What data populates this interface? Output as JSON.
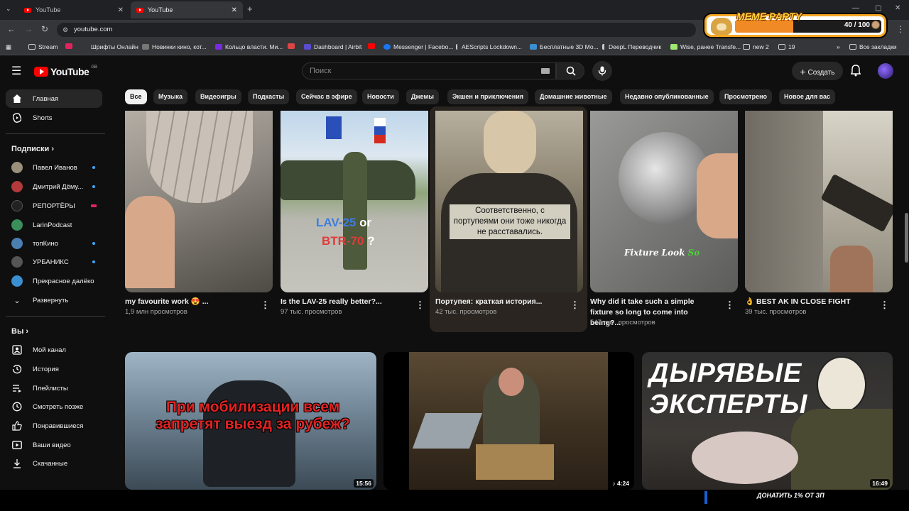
{
  "browser": {
    "tabs": [
      {
        "title": "YouTube",
        "active": false
      },
      {
        "title": "YouTube",
        "active": true
      }
    ],
    "url": "youtube.com",
    "bookmarks": [
      "Stream",
      "Шрифты Онлайн",
      "Новинки кино, кот...",
      "Кольцо власти. Ми...",
      "Dashboard | Airbit",
      "Messenger | Facebo...",
      "AEScripts Lockdown...",
      "Бесплатные 3D Мо...",
      "DeepL Переводчик",
      "Wise, ранее Transfe...",
      "new 2",
      "19"
    ],
    "all_bookmarks": "Все закладки"
  },
  "meme_party": {
    "title": "MEME PARTY",
    "count": "40 / 100",
    "progress": 0.4
  },
  "header": {
    "logo_text": "YouTube",
    "region": "GB",
    "search_placeholder": "Поиск",
    "create_label": "Создать"
  },
  "sidebar": {
    "main": [
      {
        "label": "Главная",
        "icon": "home-icon",
        "active": true
      },
      {
        "label": "Shorts",
        "icon": "shorts-icon",
        "active": false
      }
    ],
    "subscriptions_title": "Подписки",
    "subscriptions": [
      {
        "label": "Павел Иванов",
        "color": "#9a8f7a",
        "badge": "dot"
      },
      {
        "label": "Дмитрий Дёму...",
        "color": "#b23a3a",
        "badge": "dot"
      },
      {
        "label": "РЕПОРТЁРЫ",
        "color": "#222222",
        "badge": "live"
      },
      {
        "label": "LarinPodcast",
        "color": "#3a8f5a",
        "badge": "none"
      },
      {
        "label": "топКино",
        "color": "#4a7fb0",
        "badge": "dot"
      },
      {
        "label": "УРБАНИКС",
        "color": "#555555",
        "badge": "dot"
      },
      {
        "label": "Прекрасное далёко",
        "color": "#3a8fd0",
        "badge": "none"
      }
    ],
    "expand_label": "Развернуть",
    "you_title": "Вы",
    "you_items": [
      {
        "label": "Мой канал",
        "icon": "channel-icon"
      },
      {
        "label": "История",
        "icon": "history-icon"
      },
      {
        "label": "Плейлисты",
        "icon": "playlist-icon"
      },
      {
        "label": "Смотреть позже",
        "icon": "watch-later-icon"
      },
      {
        "label": "Понравившиеся",
        "icon": "like-icon"
      },
      {
        "label": "Ваши видео",
        "icon": "your-videos-icon"
      },
      {
        "label": "Скачанные",
        "icon": "download-icon"
      }
    ]
  },
  "chips": [
    "Все",
    "Музыка",
    "Видеоигры",
    "Подкасты",
    "Сейчас в эфире",
    "Новости",
    "Джемы",
    "Экшен и приключения",
    "Домашние животные",
    "Недавно опубликованные",
    "Просмотрено",
    "Новое для вас"
  ],
  "shorts": [
    {
      "title": "my favourite work 😍 ...",
      "views": "1,9 млн просмотров",
      "thumb_color": "#8a8580",
      "overlay": ""
    },
    {
      "title": "Is the LAV-25 really better?...",
      "views": "97 тыс. просмотров",
      "thumb_color": "#6a8a5a",
      "overlay_a": "LAV-25",
      "overlay_or": "or",
      "overlay_b": "BTR-70",
      "overlay_q": "?"
    },
    {
      "title": "Портупея: краткая история...",
      "views": "42 тыс. просмотров",
      "thumb_color": "#5a5448",
      "overlay": "Соответственно, с портупеями они тоже никогда не расставались."
    },
    {
      "title": "Why did it take such a simple fixture so long to come into being?...",
      "views": "547 тыс. просмотров",
      "thumb_color": "#8a8a8a",
      "overlay_a": "Fixture Look ",
      "overlay_b": "So"
    },
    {
      "title": "👌 BEST AK IN CLOSE FIGHT",
      "views": "39 тыс. просмотров",
      "thumb_color": "#a09a88",
      "overlay": ""
    }
  ],
  "videos": [
    {
      "duration": "15:56",
      "overlay": "При мобилизации всем запретят выезд за рубеж?",
      "thumb_color": "#3a4a5a"
    },
    {
      "duration": "4:24",
      "overlay": "",
      "thumb_color": "#3a3a2a"
    },
    {
      "duration": "16:49",
      "overlay": "ДЫРЯВЫЕ ЭКСПЕРТЫ",
      "thumb_color": "#3a3a3a"
    }
  ],
  "donate_banner": "ДОНАТИТЬ 1% ОТ ЗП"
}
